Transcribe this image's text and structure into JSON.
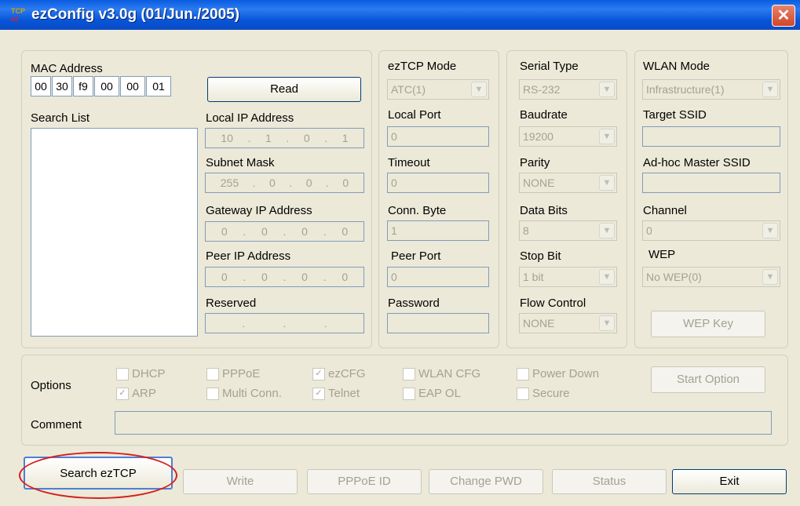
{
  "window": {
    "title": "ezConfig v3.0g (01/Jun./2005)",
    "close_label": "✕",
    "icon_top": "TCP",
    "icon_bottom": "ez"
  },
  "mac": {
    "label": "MAC Address",
    "octets": [
      "00",
      "30",
      "f9",
      "00",
      "00",
      "01"
    ],
    "read_button": "Read"
  },
  "search_list_label": "Search List",
  "network": {
    "local_ip": {
      "label": "Local IP Address",
      "parts": [
        "10",
        "1",
        "0",
        "1"
      ]
    },
    "subnet": {
      "label": "Subnet Mask",
      "parts": [
        "255",
        "0",
        "0",
        "0"
      ]
    },
    "gateway": {
      "label": "Gateway IP Address",
      "parts": [
        "0",
        "0",
        "0",
        "0"
      ]
    },
    "peer_ip": {
      "label": "Peer IP Address",
      "parts": [
        "0",
        "0",
        "0",
        "0"
      ]
    },
    "reserved": {
      "label": "Reserved",
      "parts": [
        "",
        "",
        "",
        ""
      ]
    }
  },
  "eztcp": {
    "mode_label": "ezTCP Mode",
    "mode_value": "ATC(1)",
    "local_port_label": "Local Port",
    "local_port": "0",
    "timeout_label": "Timeout",
    "timeout": "0",
    "conn_byte_label": "Conn. Byte",
    "conn_byte": "1",
    "peer_port_label": "Peer Port",
    "peer_port": "0",
    "password_label": "Password",
    "password": ""
  },
  "serial": {
    "type_label": "Serial Type",
    "type_value": "RS-232",
    "baud_label": "Baudrate",
    "baud_value": "19200",
    "parity_label": "Parity",
    "parity_value": "NONE",
    "databits_label": "Data Bits",
    "databits_value": "8",
    "stopbit_label": "Stop Bit",
    "stopbit_value": "1 bit",
    "flow_label": "Flow Control",
    "flow_value": "NONE"
  },
  "wlan": {
    "mode_label": "WLAN Mode",
    "mode_value": "Infrastructure(1)",
    "ssid_label": "Target SSID",
    "ssid": "",
    "adhoc_label": "Ad-hoc Master SSID",
    "adhoc": "",
    "channel_label": "Channel",
    "channel_value": "0",
    "wep_label": "WEP",
    "wep_value": "No WEP(0)",
    "wep_key_button": "WEP Key"
  },
  "options": {
    "label": "Options",
    "items": [
      {
        "label": "DHCP",
        "checked": false
      },
      {
        "label": "ARP",
        "checked": true
      },
      {
        "label": "PPPoE",
        "checked": false
      },
      {
        "label": "Multi Conn.",
        "checked": false
      },
      {
        "label": "ezCFG",
        "checked": true
      },
      {
        "label": "Telnet",
        "checked": true
      },
      {
        "label": "WLAN CFG",
        "checked": false
      },
      {
        "label": "EAP OL",
        "checked": false
      },
      {
        "label": "Power Down",
        "checked": false
      },
      {
        "label": "Secure",
        "checked": false
      }
    ],
    "start_option_button": "Start Option",
    "comment_label": "Comment",
    "comment": ""
  },
  "buttons": {
    "search": "Search ezTCP",
    "write": "Write",
    "pppoe": "PPPoE ID",
    "change_pwd": "Change PWD",
    "status": "Status",
    "exit": "Exit"
  },
  "check_mark": "✓",
  "dropdown_arrow": "▼",
  "ip_dot": "."
}
